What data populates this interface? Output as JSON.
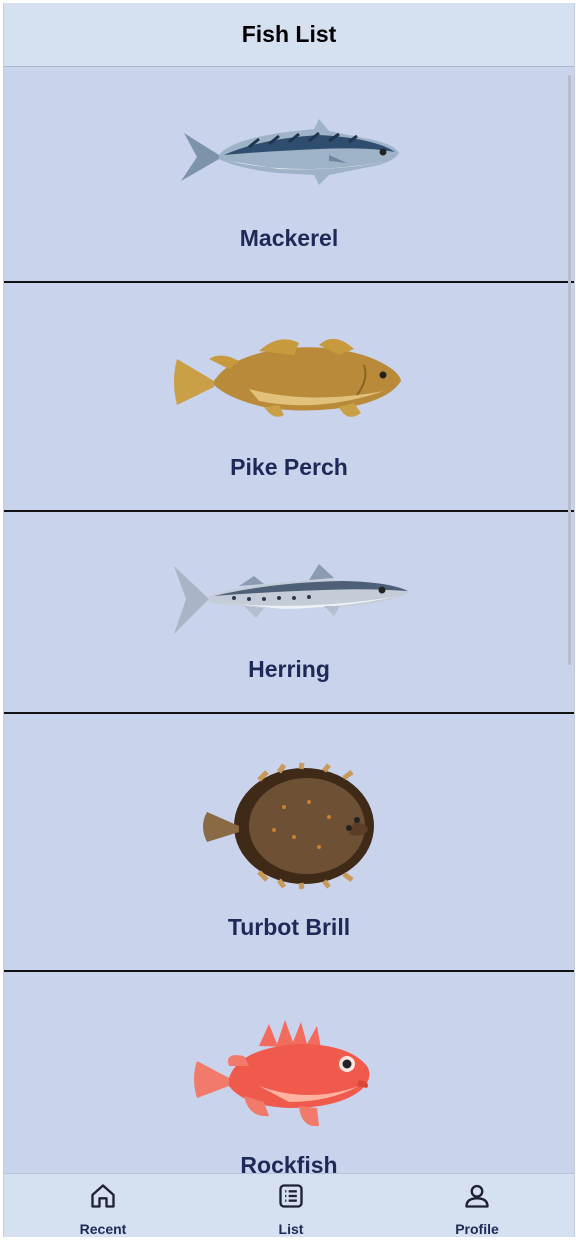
{
  "header": {
    "title": "Fish List"
  },
  "fish": [
    {
      "name": "Mackerel",
      "icon": "mackerel-image"
    },
    {
      "name": "Pike Perch",
      "icon": "pike-perch-image"
    },
    {
      "name": "Herring",
      "icon": "herring-image"
    },
    {
      "name": "Turbot Brill",
      "icon": "turbot-brill-image"
    },
    {
      "name": "Rockfish",
      "icon": "rockfish-image"
    }
  ],
  "tabs": [
    {
      "label": "Recent",
      "icon": "home-icon"
    },
    {
      "label": "List",
      "icon": "list-icon"
    },
    {
      "label": "Profile",
      "icon": "profile-icon"
    }
  ],
  "colors": {
    "background": "#c9d3ec",
    "header": "#d5e0f0",
    "text": "#1d2a57"
  }
}
